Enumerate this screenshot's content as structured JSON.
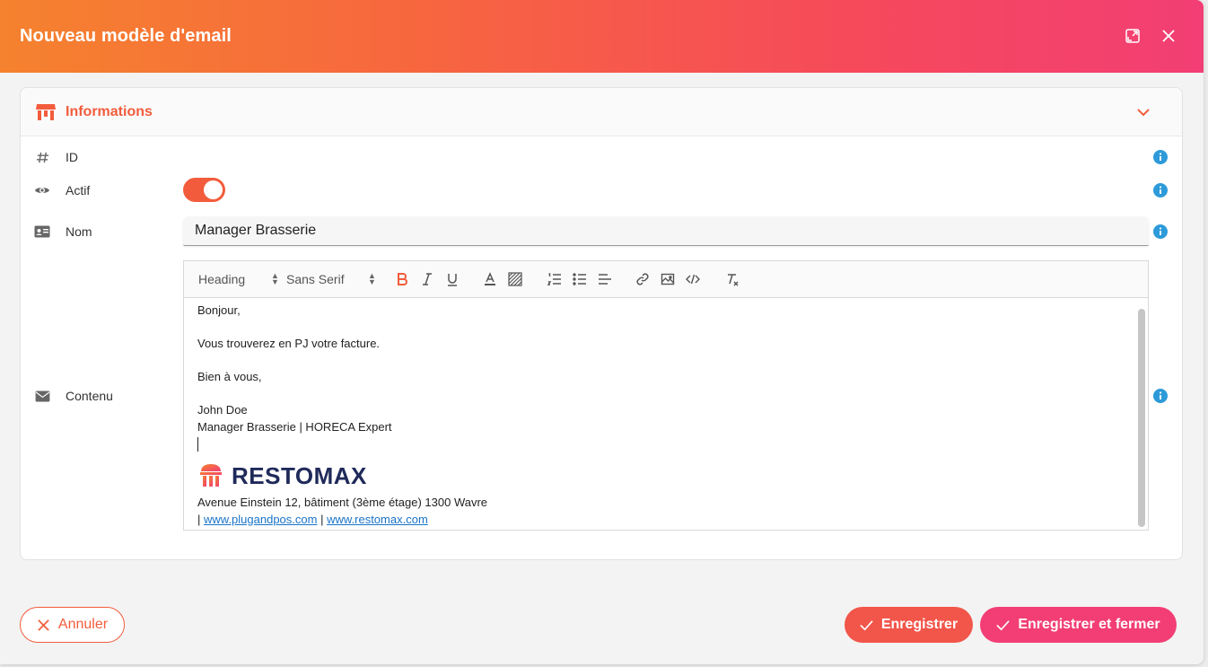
{
  "modal": {
    "title": "Nouveau modèle d'email"
  },
  "section": {
    "title": "Informations"
  },
  "fields": {
    "id_label": "ID",
    "actif_label": "Actif",
    "actif_value": true,
    "nom_label": "Nom",
    "nom_value": "Manager Brasserie",
    "contenu_label": "Contenu"
  },
  "toolbar": {
    "heading": "Heading",
    "font": "Sans Serif"
  },
  "content": {
    "line1": "Bonjour,",
    "line2": "Vous trouverez en PJ votre facture.",
    "line3": "Bien à vous,",
    "line4": "John Doe",
    "line5": "Manager Brasserie | HORECA Expert",
    "logo_text": "RESTOMAX",
    "address": "Avenue Einstein 12, bâtiment (3ème étage) 1300 Wavre",
    "link_prefix": "| ",
    "link1": "www.plugandpos.com",
    "link_sep": " | ",
    "link2": "www.restomax.com"
  },
  "buttons": {
    "cancel": "Annuler",
    "save": "Enregistrer",
    "save_close": "Enregistrer et fermer"
  },
  "colors": {
    "accent": "#f25c3c",
    "pink": "#f23e74",
    "info": "#2d9ad9",
    "link": "#1a73c8"
  },
  "icons": [
    "expand-icon",
    "close-icon",
    "store-icon",
    "chevron-down-icon",
    "hash-icon",
    "eye-icon",
    "id-card-icon",
    "envelope-icon",
    "info-icon",
    "bold-icon",
    "italic-icon",
    "underline-icon",
    "text-color-icon",
    "background-color-icon",
    "ordered-list-icon",
    "bullet-list-icon",
    "align-icon",
    "link-icon",
    "image-icon",
    "code-icon",
    "clear-format-icon",
    "check-icon",
    "x-icon"
  ]
}
